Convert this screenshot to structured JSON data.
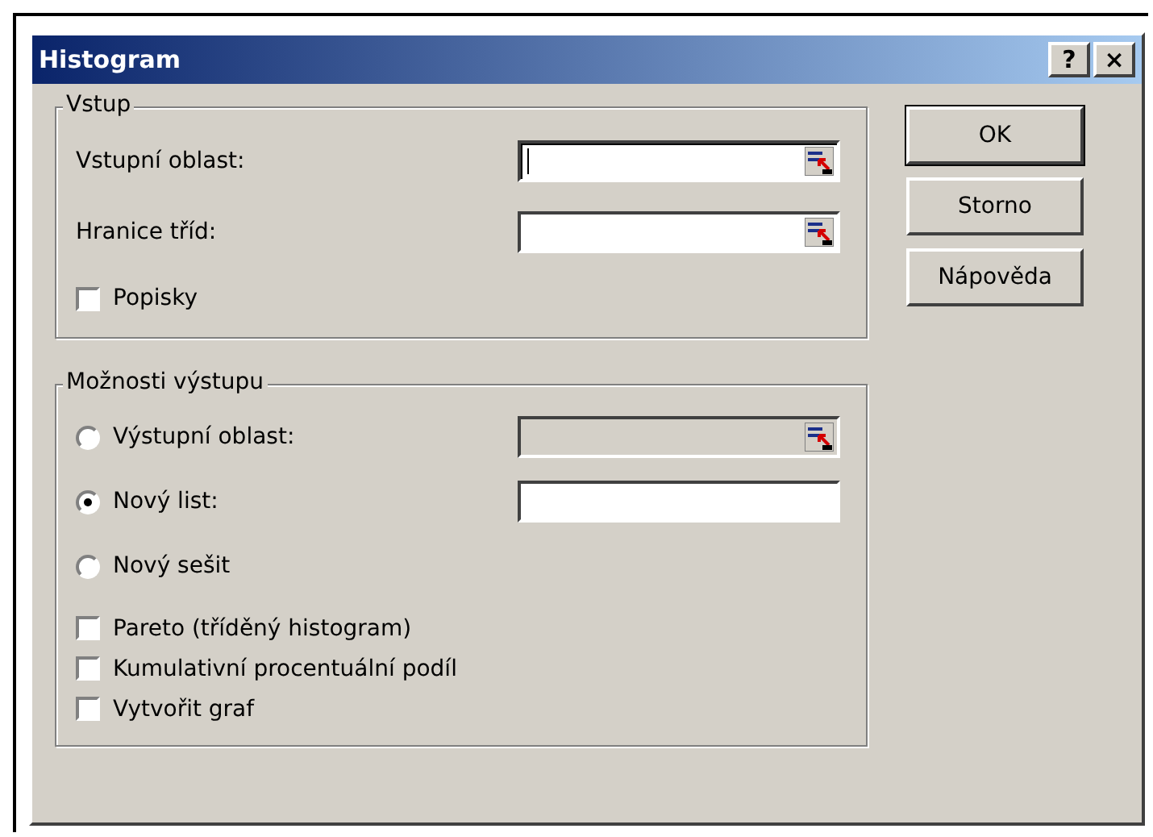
{
  "window": {
    "title": "Histogram",
    "help_button": "?",
    "close_button": "×"
  },
  "input_group": {
    "title": "Vstup",
    "fields": [
      {
        "label": "Vstupní oblast:",
        "disabled": false,
        "focused": true
      },
      {
        "label": "Hranice tříd:",
        "disabled": false,
        "focused": false
      }
    ],
    "checkbox": {
      "label": "Popisky",
      "checked": false
    }
  },
  "output_group": {
    "title": "Možnosti výstupu",
    "radios": [
      {
        "label": "Výstupní oblast:",
        "selected": false,
        "field": {
          "disabled": true,
          "picker": true
        }
      },
      {
        "label": "Nový list:",
        "selected": true,
        "field": {
          "disabled": false,
          "picker": false
        }
      },
      {
        "label": "Nový sešit",
        "selected": false
      }
    ],
    "checkboxes": [
      {
        "label": "Pareto (tříděný histogram)",
        "checked": false
      },
      {
        "label": "Kumulativní procentuální podíl",
        "checked": false
      },
      {
        "label": "Vytvořit graf",
        "checked": false
      }
    ]
  },
  "buttons": [
    {
      "label": "OK",
      "default": true
    },
    {
      "label": "Storno",
      "default": false
    },
    {
      "label": "Nápověda",
      "default": false
    }
  ]
}
